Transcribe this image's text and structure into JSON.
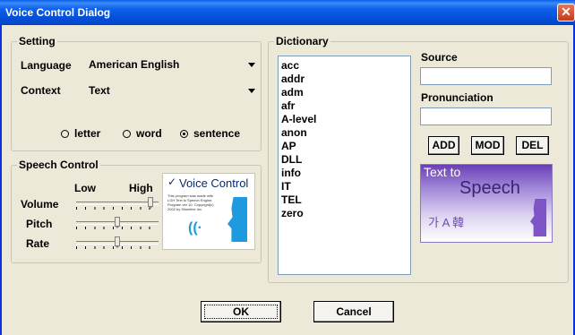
{
  "window": {
    "title": "Voice Control Dialog",
    "close_glyph": "✕"
  },
  "setting": {
    "legend": "Setting",
    "language_label": "Language",
    "language_value": "American English",
    "context_label": "Context",
    "context_value": "Text",
    "radios": [
      {
        "label": "letter",
        "selected": false
      },
      {
        "label": "word",
        "selected": false
      },
      {
        "label": "sentence",
        "selected": true
      }
    ]
  },
  "speech_control": {
    "legend": "Speech Control",
    "low_label": "Low",
    "high_label": "High",
    "volume_label": "Volume",
    "pitch_label": "Pitch",
    "rate_label": "Rate",
    "levels": {
      "volume": 0.93,
      "pitch": 0.5,
      "rate": 0.5
    }
  },
  "logo": {
    "title": "Voice Control",
    "text": "This program was made with LGH Text to Speech Engine. Program ver 10. Copyright(c) 2002 by Slimeline Inc.",
    "icon": "speaker-head-icon"
  },
  "dictionary": {
    "legend": "Dictionary",
    "items": [
      "acc",
      "addr",
      "adm",
      "afr",
      "A-level",
      "anon",
      "AP",
      "DLL",
      "info",
      "IT",
      "TEL",
      "zero"
    ],
    "source_label": "Source",
    "source_value": "",
    "pronunciation_label": "Pronunciation",
    "pronunciation_value": "",
    "add_label": "ADD",
    "mod_label": "MOD",
    "del_label": "DEL"
  },
  "tts_banner": {
    "line1": "Text to",
    "line2": "Speech",
    "deco": "가 A 韓"
  },
  "buttons": {
    "ok": "OK",
    "cancel": "Cancel"
  },
  "colors": {
    "titlebar": "#0A5DEB",
    "dialog_bg": "#ECE9D8",
    "accent": "#1E9AE0",
    "tts_purple": "#6A3FB5"
  }
}
